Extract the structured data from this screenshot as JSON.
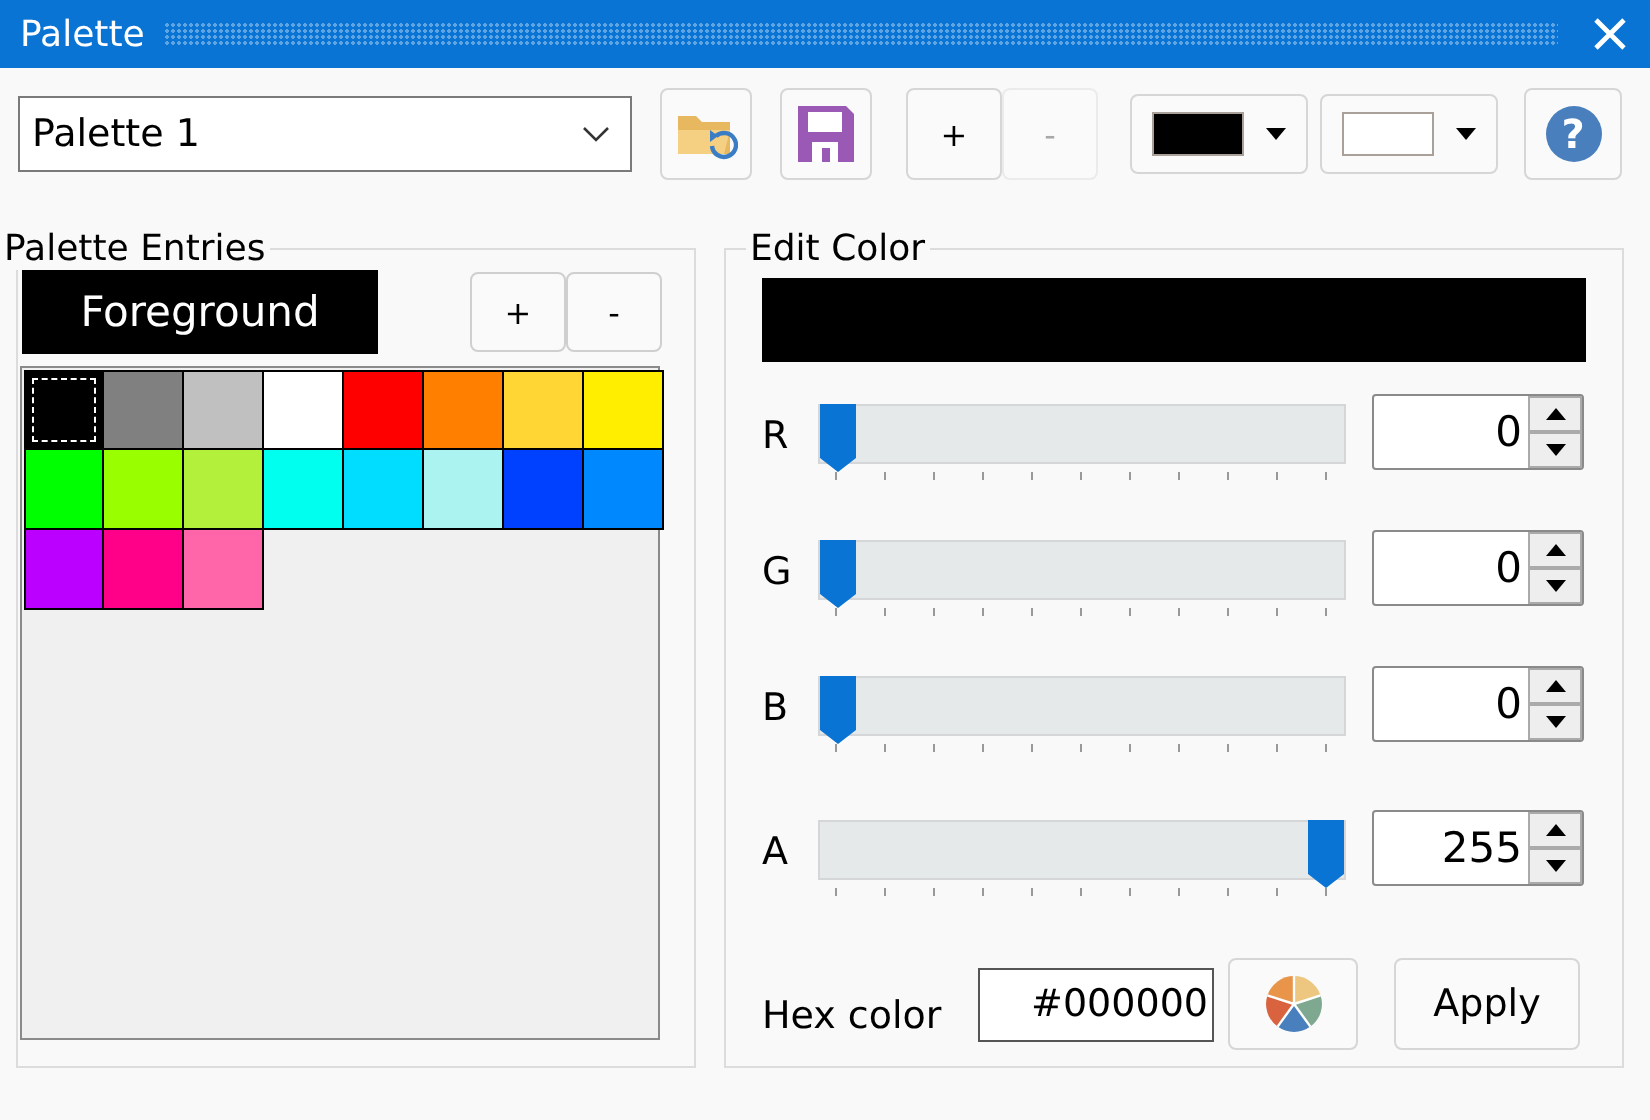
{
  "window": {
    "title": "Palette"
  },
  "toolbar": {
    "palette_select": {
      "value": "Palette 1"
    },
    "add": {
      "label": "+",
      "disabled": false
    },
    "remove": {
      "label": "-",
      "disabled": true
    },
    "foreground": {
      "color": "#000000"
    },
    "background": {
      "color": "#ffffff"
    },
    "help": {
      "label": "?"
    }
  },
  "palette_entries": {
    "title": "Palette Entries",
    "target": "Foreground",
    "add": "+",
    "remove": "-",
    "swatches": [
      {
        "color": "#000000",
        "selected": true
      },
      {
        "color": "#808080",
        "selected": false
      },
      {
        "color": "#c0c0c0",
        "selected": false
      },
      {
        "color": "#ffffff",
        "selected": false
      },
      {
        "color": "#ff0000",
        "selected": false
      },
      {
        "color": "#ff7f00",
        "selected": false
      },
      {
        "color": "#ffd633",
        "selected": false
      },
      {
        "color": "#ffee00",
        "selected": false
      },
      {
        "color": "#00ff00",
        "selected": false
      },
      {
        "color": "#99ff00",
        "selected": false
      },
      {
        "color": "#b3f03c",
        "selected": false
      },
      {
        "color": "#00ffee",
        "selected": false
      },
      {
        "color": "#00ddff",
        "selected": false
      },
      {
        "color": "#aaf3f0",
        "selected": false
      },
      {
        "color": "#0040ff",
        "selected": false
      },
      {
        "color": "#0088ff",
        "selected": false
      },
      {
        "color": "#bb00ff",
        "selected": false
      },
      {
        "color": "#ff0088",
        "selected": false
      },
      {
        "color": "#ff66aa",
        "selected": false
      }
    ]
  },
  "edit_color": {
    "title": "Edit Color",
    "preview": {
      "color": "#000000"
    },
    "channels": [
      {
        "label": "R",
        "level": 0,
        "value": "0"
      },
      {
        "label": "G",
        "level": 0,
        "value": "0"
      },
      {
        "label": "B",
        "level": 0,
        "value": "0"
      },
      {
        "label": "A",
        "level": 1,
        "value": "255"
      }
    ],
    "hex_label": "Hex color",
    "hex_value": "#000000",
    "apply": "Apply"
  }
}
